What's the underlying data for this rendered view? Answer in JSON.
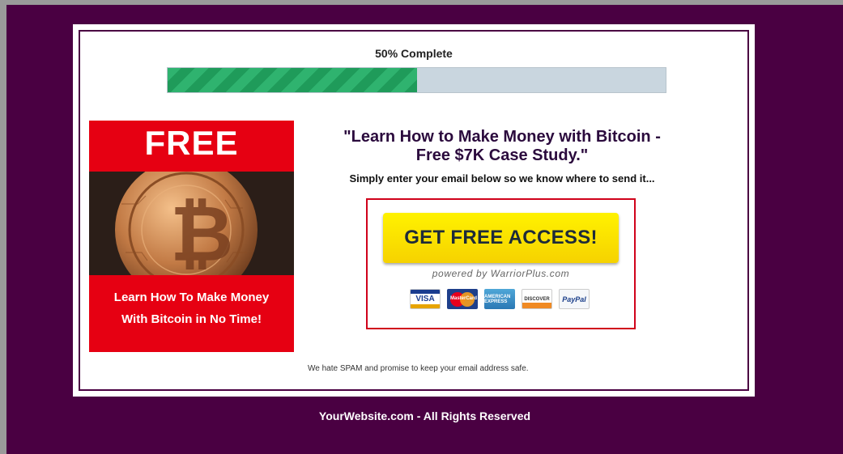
{
  "progress": {
    "label": "50% Complete",
    "value_percent": 50,
    "fill_color": "#2fb36f",
    "track_color": "#c9d6df"
  },
  "promo": {
    "badge": "FREE",
    "line1": "Learn How To Make Money",
    "line2": "With Bitcoin in No Time!",
    "image_icon": "bitcoin-coin-image"
  },
  "headline": {
    "line1": "\"Learn How to Make Money with Bitcoin -",
    "line2": "Free $7K Case Study.\""
  },
  "subline": "Simply enter your email below so we know where to send it...",
  "cta": {
    "button_label": "GET FREE ACCESS!",
    "powered_by": "powered by WarriorPlus.com",
    "payment_methods": [
      "VISA",
      "MasterCard",
      "AMERICAN EXPRESS",
      "DISCOVER",
      "PayPal"
    ]
  },
  "spam_note": "We hate SPAM and promise to keep your email address safe.",
  "footer": "YourWebsite.com - All Rights Reserved",
  "colors": {
    "page_background": "#4a0042",
    "promo_red": "#e60012",
    "cta_yellow": "#fff200",
    "cta_border": "#d0021b"
  }
}
